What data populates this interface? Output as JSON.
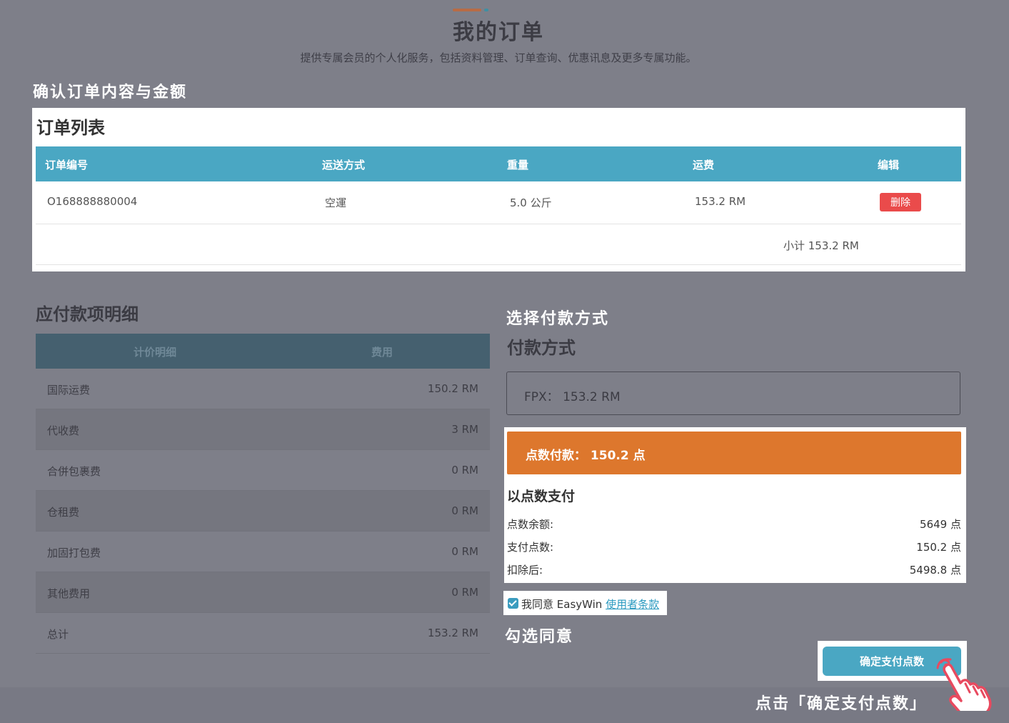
{
  "header": {
    "title": "我的订单",
    "subtitle": "提供专属会员的个人化服务，包括资料管理、订单查询、优惠讯息及更多专属功能。"
  },
  "annotations": {
    "confirm_order": "确认订单内容与金额",
    "choose_payment": "选择付款方式",
    "check_agree": "勾选同意",
    "click_confirm": "点击「确定支付点数」"
  },
  "order_list": {
    "title": "订单列表",
    "columns": [
      "订单编号",
      "运送方式",
      "重量",
      "运费",
      "编辑"
    ],
    "rows": [
      {
        "order_no": "O168888880004",
        "shipping": "空運",
        "weight": "5.0 公斤",
        "fee": "153.2 RM",
        "action": "删除"
      }
    ],
    "subtotal": "小计 153.2 RM"
  },
  "payable": {
    "title": "应付款项明细",
    "columns": [
      "计价明细",
      "费用"
    ],
    "rows": [
      {
        "label": "国际运费",
        "value": "150.2 RM"
      },
      {
        "label": "代收费",
        "value": "3 RM"
      },
      {
        "label": "合併包裹费",
        "value": "0 RM"
      },
      {
        "label": "仓租费",
        "value": "0 RM"
      },
      {
        "label": "加固打包费",
        "value": "0 RM"
      },
      {
        "label": "其他费用",
        "value": "0 RM"
      },
      {
        "label": "总计",
        "value": "153.2 RM"
      }
    ]
  },
  "payment": {
    "title": "付款方式",
    "fpx": "FPX： 153.2 RM",
    "points_option": "点数付款： 150.2 点",
    "points_section_title": "以点数支付",
    "balance_label": "点数余额:",
    "balance_value": "5649 点",
    "pay_label": "支付点数:",
    "pay_value": "150.2 点",
    "after_label": "扣除后:",
    "after_value": "5498.8 点",
    "agree_prefix": "我同意 EasyWin ",
    "agree_link": "使用者条款",
    "agree_checked": true,
    "confirm_button": "确定支付点数"
  },
  "colors": {
    "overlay": "#7e7f89",
    "accent_blue": "#4aa7c3",
    "accent_orange": "#dd772d",
    "danger_red": "#ea4b4b"
  }
}
